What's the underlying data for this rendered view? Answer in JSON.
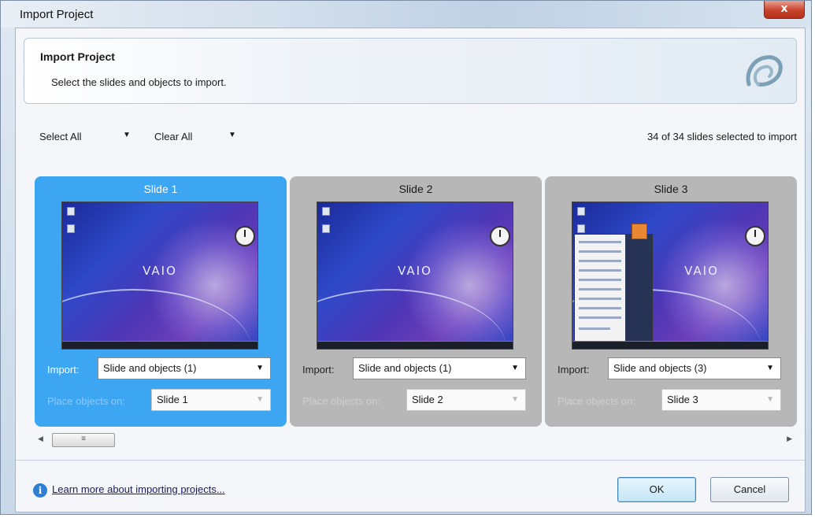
{
  "window": {
    "title": "Import Project",
    "close_label": "x"
  },
  "header": {
    "title": "Import Project",
    "subtitle": "Select the slides and objects to import.",
    "logo_icon": "project-logo-icon"
  },
  "toolbar": {
    "select_all": "Select All",
    "clear_all": "Clear All",
    "selected_count": "34 of 34 slides selected to import"
  },
  "slides": [
    {
      "title": "Slide 1",
      "selected": true,
      "import_label": "Import:",
      "import_value": "Slide and objects (1)",
      "place_label": "Place objects on:",
      "place_value": "Slide 1"
    },
    {
      "title": "Slide 2",
      "selected": false,
      "import_label": "Import:",
      "import_value": "Slide and objects (1)",
      "place_label": "Place objects on:",
      "place_value": "Slide 2"
    },
    {
      "title": "Slide 3",
      "selected": false,
      "import_label": "Import:",
      "import_value": "Slide and objects (3)",
      "place_label": "Place objects on:",
      "place_value": "Slide 3"
    }
  ],
  "thumbnail": {
    "brand_text": "VAIO"
  },
  "footer": {
    "learn_more": "Learn more about importing projects...",
    "ok": "OK",
    "cancel": "Cancel"
  },
  "colors": {
    "selected_card": "#3da6f3",
    "unselected_card": "#b7b7b7",
    "accent": "#2f7fd3"
  }
}
